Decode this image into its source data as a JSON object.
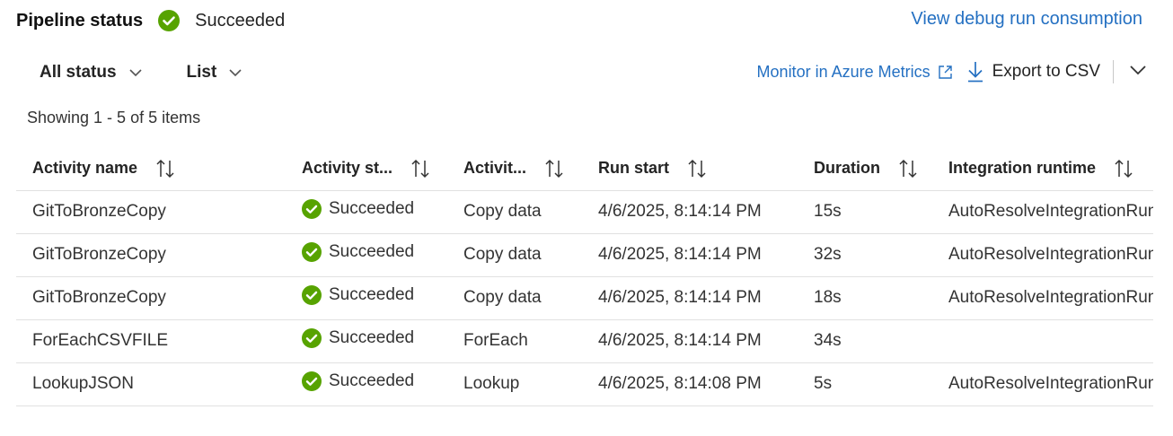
{
  "header": {
    "title": "Pipeline status",
    "status": "Succeeded",
    "debug_link": "View debug run consumption"
  },
  "toolbar": {
    "status_filter": "All status",
    "view_mode": "List",
    "metrics_link": "Monitor in Azure Metrics",
    "export_label": "Export to CSV"
  },
  "summary": "Showing 1 - 5 of 5 items",
  "table": {
    "columns": [
      "Activity name",
      "Activity st...",
      "Activit...",
      "Run start",
      "Duration",
      "Integration runtime"
    ],
    "rows": [
      {
        "name": "GitToBronzeCopy",
        "status": "Succeeded",
        "type": "Copy data",
        "start": "4/6/2025, 8:14:14 PM",
        "duration": "15s",
        "runtime": "AutoResolveIntegrationRun"
      },
      {
        "name": "GitToBronzeCopy",
        "status": "Succeeded",
        "type": "Copy data",
        "start": "4/6/2025, 8:14:14 PM",
        "duration": "32s",
        "runtime": "AutoResolveIntegrationRun"
      },
      {
        "name": "GitToBronzeCopy",
        "status": "Succeeded",
        "type": "Copy data",
        "start": "4/6/2025, 8:14:14 PM",
        "duration": "18s",
        "runtime": "AutoResolveIntegrationRun"
      },
      {
        "name": "ForEachCSVFILE",
        "status": "Succeeded",
        "type": "ForEach",
        "start": "4/6/2025, 8:14:14 PM",
        "duration": "34s",
        "runtime": ""
      },
      {
        "name": "LookupJSON",
        "status": "Succeeded",
        "type": "Lookup",
        "start": "4/6/2025, 8:14:08 PM",
        "duration": "5s",
        "runtime": "AutoResolveIntegrationRun"
      }
    ]
  },
  "colors": {
    "success": "#57a300",
    "link": "#2470c2"
  },
  "icons": {
    "status": "check-circle-icon",
    "sort": "sort-arrows-icon",
    "dropdown": "chevron-down-icon",
    "external": "external-link-icon",
    "download": "download-icon"
  }
}
